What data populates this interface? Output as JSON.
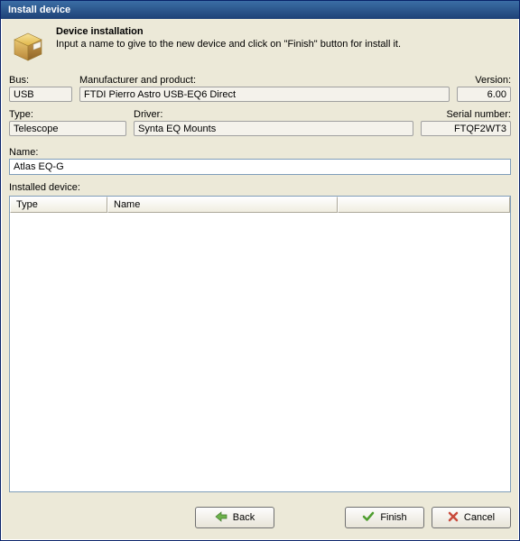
{
  "window": {
    "title": "Install device"
  },
  "header": {
    "title": "Device installation",
    "subtitle": "Input a name to give to the new device and click on \"Finish\" button for install it."
  },
  "row1": {
    "bus": {
      "label": "Bus:",
      "value": "USB"
    },
    "manufacturer": {
      "label": "Manufacturer and product:",
      "value": "FTDI Pierro Astro USB-EQ6 Direct"
    },
    "version": {
      "label": "Version:",
      "value": "6.00"
    }
  },
  "row2": {
    "type": {
      "label": "Type:",
      "value": "Telescope"
    },
    "driver": {
      "label": "Driver:",
      "value": "Synta EQ Mounts"
    },
    "serial": {
      "label": "Serial number:",
      "value": "FTQF2WT3"
    }
  },
  "name": {
    "label": "Name:",
    "value": "Atlas EQ-G"
  },
  "installed": {
    "label": "Installed device:",
    "columns": {
      "type": "Type",
      "name": "Name"
    }
  },
  "buttons": {
    "back": "Back",
    "finish": "Finish",
    "cancel": "Cancel"
  }
}
